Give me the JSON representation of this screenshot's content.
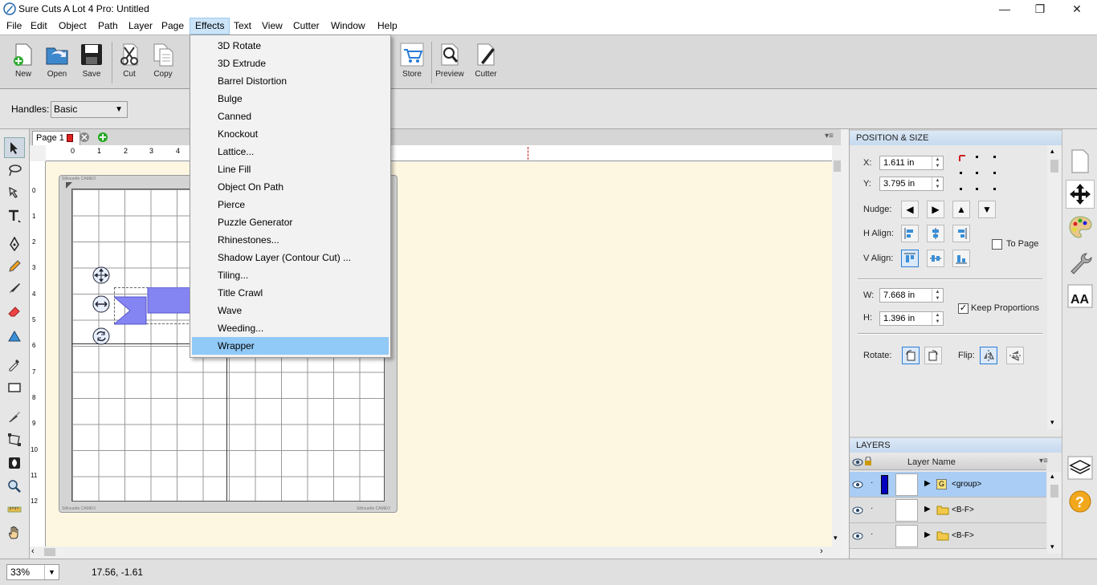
{
  "window": {
    "title": "Sure Cuts A Lot 4 Pro: Untitled",
    "minimize": "—",
    "maximize": "❐",
    "close": "✕"
  },
  "menubar": [
    "File",
    "Edit",
    "Object",
    "Path",
    "Layer",
    "Page",
    "Effects",
    "Text",
    "View",
    "Cutter",
    "Window",
    "Help"
  ],
  "toolbar": {
    "new": "New",
    "open": "Open",
    "save": "Save",
    "cut": "Cut",
    "copy": "Copy",
    "store": "Store",
    "preview": "Preview",
    "cutter": "Cutter"
  },
  "options": {
    "handles_label": "Handles:",
    "handles_value": "Basic"
  },
  "tabs": {
    "page": "Page 1"
  },
  "ruler": {
    "h_ticks": [
      "0",
      "1",
      "2",
      "3",
      "4"
    ],
    "v_ticks": [
      "0",
      "1",
      "2",
      "3",
      "4",
      "5",
      "6",
      "7",
      "8",
      "9",
      "10",
      "11",
      "12"
    ]
  },
  "mat": {
    "label_tl": "Silhouette CAMEO",
    "label_bl": "Silhouette CAMEO",
    "label_br": "Silhouette CAMEO"
  },
  "status": {
    "zoom": "33%",
    "coords": "17.56, -1.61"
  },
  "position_size": {
    "header": "POSITION & SIZE",
    "x_label": "X:",
    "x_value": "1.611 in",
    "y_label": "Y:",
    "y_value": "3.795 in",
    "nudge_label": "Nudge:",
    "halign_label": "H Align:",
    "valign_label": "V Align:",
    "to_page": "To Page",
    "w_label": "W:",
    "w_value": "7.668 in",
    "h_label": "H:",
    "h_value": "1.396 in",
    "keep_proportions": "Keep Proportions",
    "rotate_label": "Rotate:",
    "flip_label": "Flip:"
  },
  "layers": {
    "header": "LAYERS",
    "column": "Layer Name",
    "rows": [
      {
        "name": "<group>",
        "badge": "G",
        "selected": true
      },
      {
        "name": "<B-F>",
        "badge": "",
        "selected": false
      },
      {
        "name": "<B-F>",
        "badge": "",
        "selected": false
      }
    ]
  },
  "effects_menu": {
    "items": [
      "3D Rotate",
      "3D Extrude",
      "Barrel Distortion",
      "Bulge",
      "Canned",
      "Knockout",
      "Lattice...",
      "Line Fill",
      "Object On Path",
      "Pierce",
      "Puzzle Generator",
      "Rhinestones...",
      "Shadow Layer (Contour Cut) ...",
      "Tiling...",
      "Title Crawl",
      "Wave",
      "Weeding...",
      "Wrapper"
    ],
    "highlighted": "Wrapper"
  },
  "colors": {
    "accent": "#91c9f7",
    "shape_fill": "#8484f2",
    "mat_bg": "#fdf7e1"
  }
}
